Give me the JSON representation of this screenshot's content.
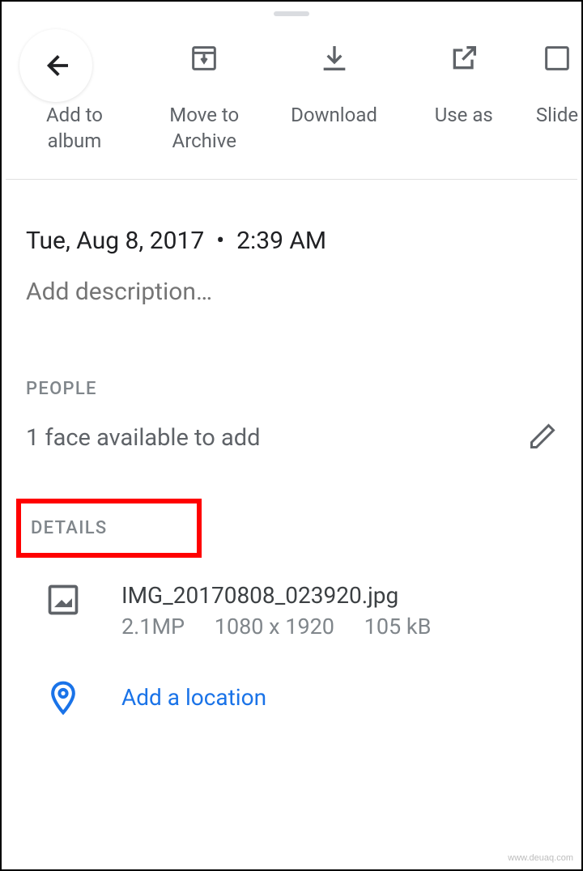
{
  "actions": {
    "add_to_album": "Add to\nalbum",
    "move_to_archive": "Move to\nArchive",
    "download": "Download",
    "use_as": "Use as",
    "slideshow": "Slide"
  },
  "info": {
    "date": "Tue, Aug 8, 2017",
    "time": "2:39 AM",
    "description_placeholder": "Add description…"
  },
  "people": {
    "header": "PEOPLE",
    "faces_text": "1 face available to add"
  },
  "details": {
    "header": "DETAILS",
    "filename": "IMG_20170808_023920.jpg",
    "megapixels": "2.1MP",
    "resolution": "1080 x 1920",
    "file_size": "105 kB",
    "add_location": "Add a location"
  },
  "watermark": "www.deuaq.com"
}
